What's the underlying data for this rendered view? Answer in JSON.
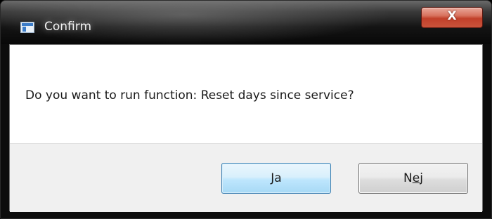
{
  "window": {
    "title": "Confirm",
    "icon": "app-window-icon",
    "close_glyph": "X"
  },
  "dialog": {
    "message": "Do you want to run function: Reset days since service?"
  },
  "buttons": {
    "yes_label": "Ja",
    "no_label_prefix": "N",
    "no_label_mnemonic": "e",
    "no_label_suffix": "j",
    "no_label": "Nej"
  },
  "colors": {
    "default_button_border": "#3c7fb1",
    "close_button": "#c1402a"
  }
}
